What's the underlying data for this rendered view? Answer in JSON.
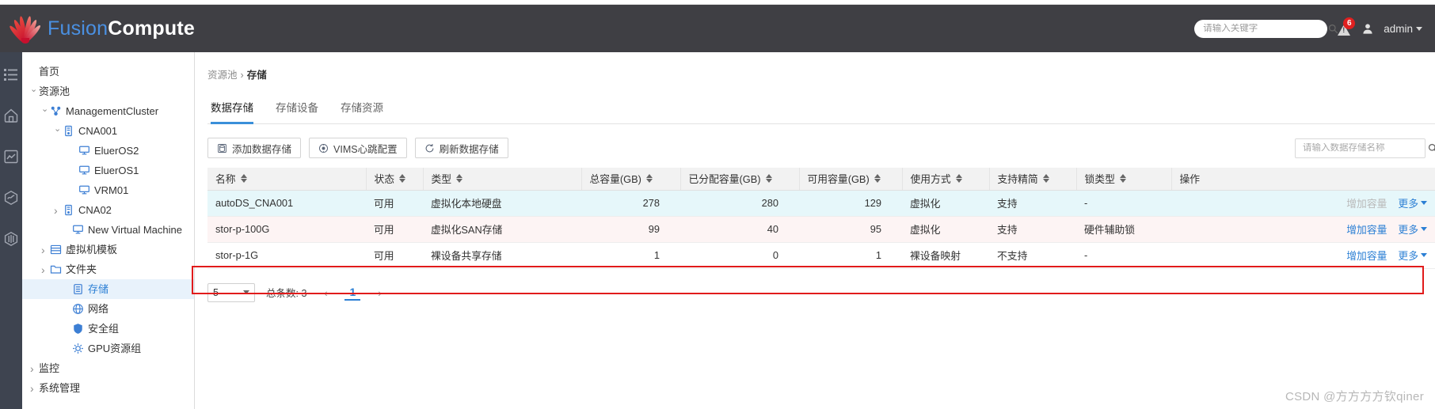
{
  "header": {
    "brand_first": "Fusion",
    "brand_second": "Compute",
    "search_placeholder": "请输入关键字",
    "alert_badge": "6",
    "user_name": "admin"
  },
  "rail": {
    "items": [
      {
        "icon": "list-icon"
      },
      {
        "icon": "home-icon"
      },
      {
        "icon": "monitor-chart-icon"
      },
      {
        "icon": "hexagon-wave-icon"
      },
      {
        "icon": "storage-cylinder-icon"
      }
    ]
  },
  "sidebar": {
    "items": [
      {
        "label": "首页",
        "indent": 1,
        "chev": "",
        "icon": "",
        "selected": false
      },
      {
        "label": "资源池",
        "indent": 1,
        "chev": "down",
        "icon": "",
        "selected": false
      },
      {
        "label": "ManagementCluster",
        "indent": 2,
        "chev": "down",
        "icon": "cluster-icon",
        "selected": false
      },
      {
        "label": "CNA001",
        "indent": 3,
        "chev": "down",
        "icon": "host-icon",
        "selected": false
      },
      {
        "label": "EluerOS2",
        "indent": 4,
        "chev": "",
        "icon": "vm-icon",
        "selected": false
      },
      {
        "label": "EluerOS1",
        "indent": 4,
        "chev": "",
        "icon": "vm-icon",
        "selected": false
      },
      {
        "label": "VRM01",
        "indent": 4,
        "chev": "",
        "icon": "vm-icon",
        "selected": false
      },
      {
        "label": "CNA02",
        "indent": 3,
        "chev": "right",
        "icon": "host-icon",
        "selected": false
      },
      {
        "label": "New Virtual Machine",
        "indent": 5,
        "chev": "",
        "icon": "vm-icon",
        "selected": false
      },
      {
        "label": "虚拟机模板",
        "indent": 2,
        "chev": "right",
        "icon": "template-icon",
        "selected": false
      },
      {
        "label": "文件夹",
        "indent": 2,
        "chev": "right",
        "icon": "folder-icon",
        "selected": false
      },
      {
        "label": "存储",
        "indent": 5,
        "chev": "",
        "icon": "storage-icon",
        "selected": true
      },
      {
        "label": "网络",
        "indent": 5,
        "chev": "",
        "icon": "network-icon",
        "selected": false
      },
      {
        "label": "安全组",
        "indent": 5,
        "chev": "",
        "icon": "shield-icon",
        "selected": false
      },
      {
        "label": "GPU资源组",
        "indent": 5,
        "chev": "",
        "icon": "gpu-icon",
        "selected": false
      },
      {
        "label": "监控",
        "indent": 1,
        "chev": "right",
        "icon": "",
        "selected": false
      },
      {
        "label": "系统管理",
        "indent": 1,
        "chev": "right",
        "icon": "",
        "selected": false
      }
    ]
  },
  "breadcrumb": {
    "parent": "资源池",
    "separator": "›",
    "current": "存储"
  },
  "tabs": [
    {
      "label": "数据存储",
      "active": true
    },
    {
      "label": "存储设备",
      "active": false
    },
    {
      "label": "存储资源",
      "active": false
    }
  ],
  "toolbar": {
    "add_label": "添加数据存储",
    "vims_label": "VIMS心跳配置",
    "refresh_label": "刷新数据存储",
    "search_placeholder": "请输入数据存储名称"
  },
  "table": {
    "columns": [
      {
        "label": "名称",
        "sortable": true,
        "align": "left"
      },
      {
        "label": "状态",
        "sortable": true,
        "align": "left"
      },
      {
        "label": "类型",
        "sortable": true,
        "align": "left"
      },
      {
        "label": "总容量(GB)",
        "sortable": true,
        "align": "right"
      },
      {
        "label": "已分配容量(GB)",
        "sortable": true,
        "align": "right"
      },
      {
        "label": "可用容量(GB)",
        "sortable": true,
        "align": "right"
      },
      {
        "label": "使用方式",
        "sortable": true,
        "align": "left"
      },
      {
        "label": "支持精简",
        "sortable": true,
        "align": "left"
      },
      {
        "label": "锁类型",
        "sortable": true,
        "align": "left"
      },
      {
        "label": "操作",
        "sortable": false,
        "align": "left"
      }
    ],
    "rows": [
      {
        "name": "autoDS_CNA001",
        "status": "可用",
        "type": "虚拟化本地硬盘",
        "total": "278",
        "allocated": "280",
        "available": "129",
        "usage": "虚拟化",
        "thin": "支持",
        "lock": "-",
        "action_primary": "增加容量",
        "action_primary_enabled": false,
        "action_more": "更多"
      },
      {
        "name": "stor-p-100G",
        "status": "可用",
        "type": "虚拟化SAN存储",
        "total": "99",
        "allocated": "40",
        "available": "95",
        "usage": "虚拟化",
        "thin": "支持",
        "lock": "硬件辅助锁",
        "action_primary": "增加容量",
        "action_primary_enabled": true,
        "action_more": "更多"
      },
      {
        "name": "stor-p-1G",
        "status": "可用",
        "type": "裸设备共享存储",
        "total": "1",
        "allocated": "0",
        "available": "1",
        "usage": "裸设备映射",
        "thin": "不支持",
        "lock": "-",
        "action_primary": "增加容量",
        "action_primary_enabled": true,
        "action_more": "更多"
      }
    ]
  },
  "footer": {
    "page_size": "5",
    "total_label": "总条数: 3",
    "prev": "‹",
    "page_current": "1",
    "next": "›"
  },
  "watermark": "CSDN @方方方方钦qiner",
  "colors": {
    "header_bg": "#3f3f44",
    "accent_blue": "#2b7fd4",
    "tab_active": "#3a8fd9",
    "badge_red": "#e02020",
    "highlight_red": "#e11b1b",
    "row_highlight": "#e6f7fa"
  }
}
